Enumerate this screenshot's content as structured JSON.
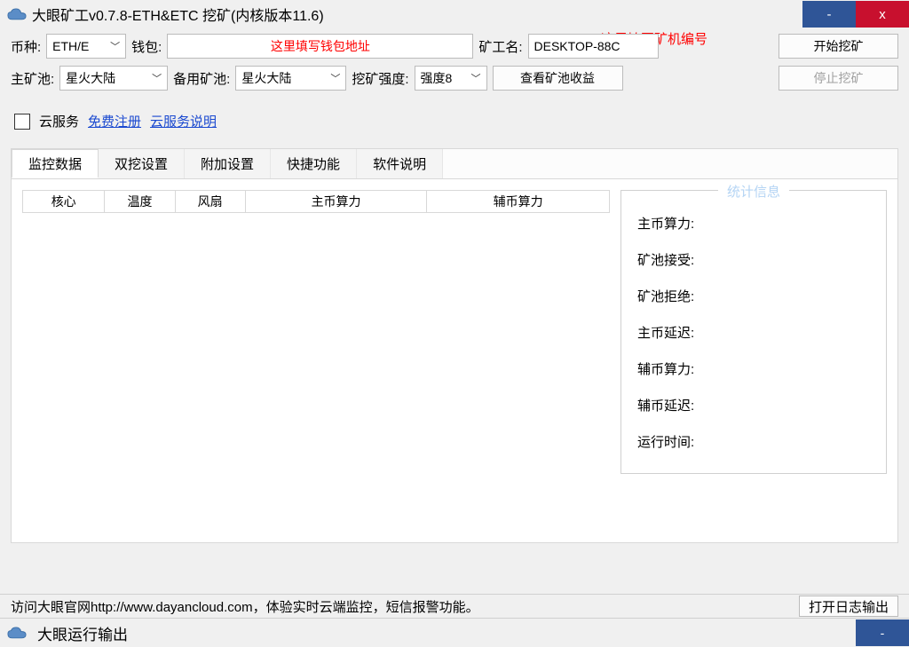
{
  "window": {
    "title": "大眼矿工v0.7.8-ETH&ETC 挖矿(内核版本11.6)",
    "min_label": "-",
    "close_label": "x"
  },
  "annotations": {
    "machine_id_hint": "这里填写矿机编号",
    "wallet_hint": "这里填写钱包地址"
  },
  "config": {
    "coin_label": "币种:",
    "coin_value": "ETH/E",
    "wallet_label": "钱包:",
    "miner_label": "矿工名:",
    "miner_value": "DESKTOP-88C",
    "start_btn": "开始挖矿",
    "main_pool_label": "主矿池:",
    "main_pool_value": "星火大陆",
    "backup_pool_label": "备用矿池:",
    "backup_pool_value": "星火大陆",
    "intensity_label": "挖矿强度:",
    "intensity_value": "强度8",
    "view_earnings_btn": "查看矿池收益",
    "stop_btn": "停止挖矿"
  },
  "cloud_service": {
    "label": "云服务",
    "register_link": "免费注册",
    "help_link": "云服务说明"
  },
  "tabs": [
    "监控数据",
    "双挖设置",
    "附加设置",
    "快捷功能",
    "软件说明"
  ],
  "table": {
    "headers": [
      "核心",
      "温度",
      "风扇",
      "主币算力",
      "辅币算力"
    ]
  },
  "stats": {
    "title": "统计信息",
    "items": [
      "主币算力:",
      "矿池接受:",
      "矿池拒绝:",
      "主币延迟:",
      "辅币算力:",
      "辅币延迟:",
      "运行时间:"
    ]
  },
  "footer": {
    "text": "访问大眼官网http://www.dayancloud.com，体验实时云端监控，短信报警功能。",
    "open_log_btn": "打开日志输出"
  },
  "bottom_bar": {
    "title": "大眼运行输出",
    "min_label": "-"
  }
}
